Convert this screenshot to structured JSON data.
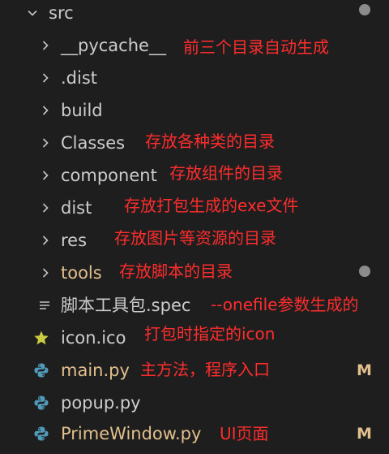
{
  "explorer": {
    "root": {
      "label": "src",
      "expanded": true,
      "has_dot": true
    },
    "folders": [
      {
        "label": "__pycache__",
        "annotation": "前三个目录自动生成"
      },
      {
        "label": ".dist",
        "annotation": ""
      },
      {
        "label": "build",
        "annotation": ""
      },
      {
        "label": "Classes",
        "annotation": "存放各种类的目录"
      },
      {
        "label": "component",
        "annotation": "存放组件的目录"
      },
      {
        "label": "dist",
        "annotation": "存放打包生成的exe文件"
      },
      {
        "label": "res",
        "annotation": "存放图片等资源的目录"
      },
      {
        "label": "tools",
        "annotation": "存放脚本的目录",
        "has_dot": true
      }
    ],
    "files": [
      {
        "label": "脚本工具包.spec",
        "icon": "lines-icon",
        "annotation": "--onefile参数生成的",
        "badge": ""
      },
      {
        "label": "icon.ico",
        "icon": "star-icon",
        "annotation": "打包时指定的icon",
        "badge": ""
      },
      {
        "label": "main.py",
        "icon": "python-icon",
        "annotation": "主方法，程序入口",
        "badge": "M"
      },
      {
        "label": "popup.py",
        "icon": "python-icon",
        "annotation": "",
        "badge": ""
      },
      {
        "label": "PrimeWindow.py",
        "icon": "python-icon",
        "annotation": "UI页面",
        "badge": "M"
      }
    ]
  },
  "colors": {
    "background": "#1e1e1e",
    "text": "#cccccc",
    "modified_text": "#e2c08d",
    "annotation": "#ff2d2d",
    "dot": "#8c8c8c",
    "python_icon": "#519aba",
    "star_icon": "#cbcb41"
  }
}
